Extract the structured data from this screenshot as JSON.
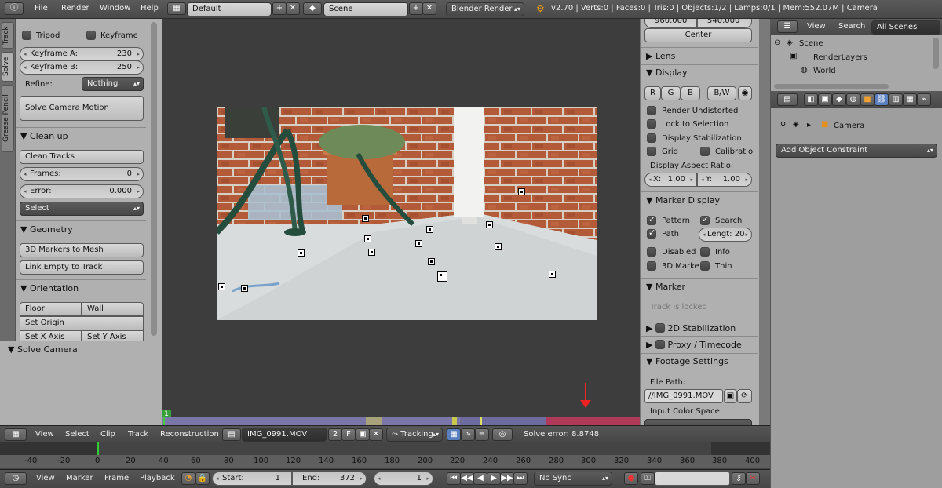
{
  "topbar": {
    "menus": [
      "File",
      "Render",
      "Window",
      "Help"
    ],
    "layout": "Default",
    "scene": "Scene",
    "engine": "Blender Render",
    "stats": "v2.70 | Verts:0 | Faces:0 | Tris:0 | Objects:1/2 | Lamps:0/1 | Mem:552.07M | Camera"
  },
  "left_tabs": [
    "Track",
    "Solve",
    "Grease Pencil"
  ],
  "left_panel": {
    "tripod": "Tripod",
    "keyframe": "Keyframe",
    "keyframe_a_label": "Keyframe A:",
    "keyframe_a_value": "230",
    "keyframe_b_label": "Keyframe B:",
    "keyframe_b_value": "250",
    "refine_label": "Refine:",
    "refine_value": "Nothing",
    "solve_button": "Solve Camera Motion",
    "cleanup_title": "Clean up",
    "clean_tracks": "Clean Tracks",
    "frames_label": "Frames:",
    "frames_value": "0",
    "error_label": "Error:",
    "error_value": "0.000",
    "select": "Select",
    "geometry_title": "Geometry",
    "markers_to_mesh": "3D Markers to Mesh",
    "link_empty": "Link Empty to Track",
    "orientation_title": "Orientation",
    "floor": "Floor",
    "wall": "Wall",
    "set_origin": "Set Origin",
    "set_x": "Set X Axis",
    "set_y": "Set Y Axis"
  },
  "left_lower": {
    "solve_camera": "Solve Camera"
  },
  "right_panel": {
    "res_x": "960.000",
    "res_y": "540.000",
    "center": "Center",
    "lens": "Lens",
    "display": "Display",
    "channels": [
      "R",
      "G",
      "B"
    ],
    "bw": "B/W",
    "render_undistorted": "Render Undistorted",
    "lock_to_selection": "Lock to Selection",
    "display_stabilization": "Display Stabilization",
    "grid": "Grid",
    "calibration": "Calibratio",
    "aspect_label": "Display Aspect Ratio:",
    "aspect_x": "1.00",
    "aspect_y": "1.00",
    "aspect_x_label": "X:",
    "aspect_y_label": "Y:",
    "marker_display": "Marker Display",
    "pattern": "Pattern",
    "search": "Search",
    "path": "Path",
    "length_label": "Lengt:",
    "length_value": "20",
    "disabled": "Disabled",
    "info": "Info",
    "markers_3d": "3D Marke",
    "thin": "Thin",
    "marker": "Marker",
    "track_locked": "Track is locked",
    "stabilization_2d": "2D Stabilization",
    "proxy": "Proxy / Timecode",
    "footage": "Footage Settings",
    "file_path_label": "File Path:",
    "file_path": "//IMG_0991.MOV",
    "color_space": "Input Color Space:"
  },
  "outliner": {
    "view": "View",
    "search": "Search",
    "all_scenes": "All Scenes",
    "scene": "Scene",
    "render_layers": "RenderLayers",
    "world": "World"
  },
  "properties": {
    "object": "Camera",
    "add_constraint": "Add Object Constraint"
  },
  "clip_header": {
    "menus": [
      "View",
      "Select",
      "Clip",
      "Track",
      "Reconstruction"
    ],
    "clip_name": "IMG_0991.MOV",
    "users": "2",
    "fake": "F",
    "mode": "Tracking",
    "solve_error": "Solve error: 8.8748",
    "current_frame_marker": "1"
  },
  "ruler": {
    "ticks": [
      "-40",
      "-20",
      "0",
      "20",
      "40",
      "60",
      "80",
      "100",
      "120",
      "140",
      "160",
      "180",
      "200",
      "220",
      "240",
      "260",
      "280",
      "300",
      "320",
      "340",
      "360",
      "380",
      "400"
    ]
  },
  "timeline_bar": {
    "menus": [
      "View",
      "Marker",
      "Frame",
      "Playback"
    ],
    "start_label": "Start:",
    "start": "1",
    "end_label": "End:",
    "end": "372",
    "current": "1",
    "sync": "No Sync"
  }
}
